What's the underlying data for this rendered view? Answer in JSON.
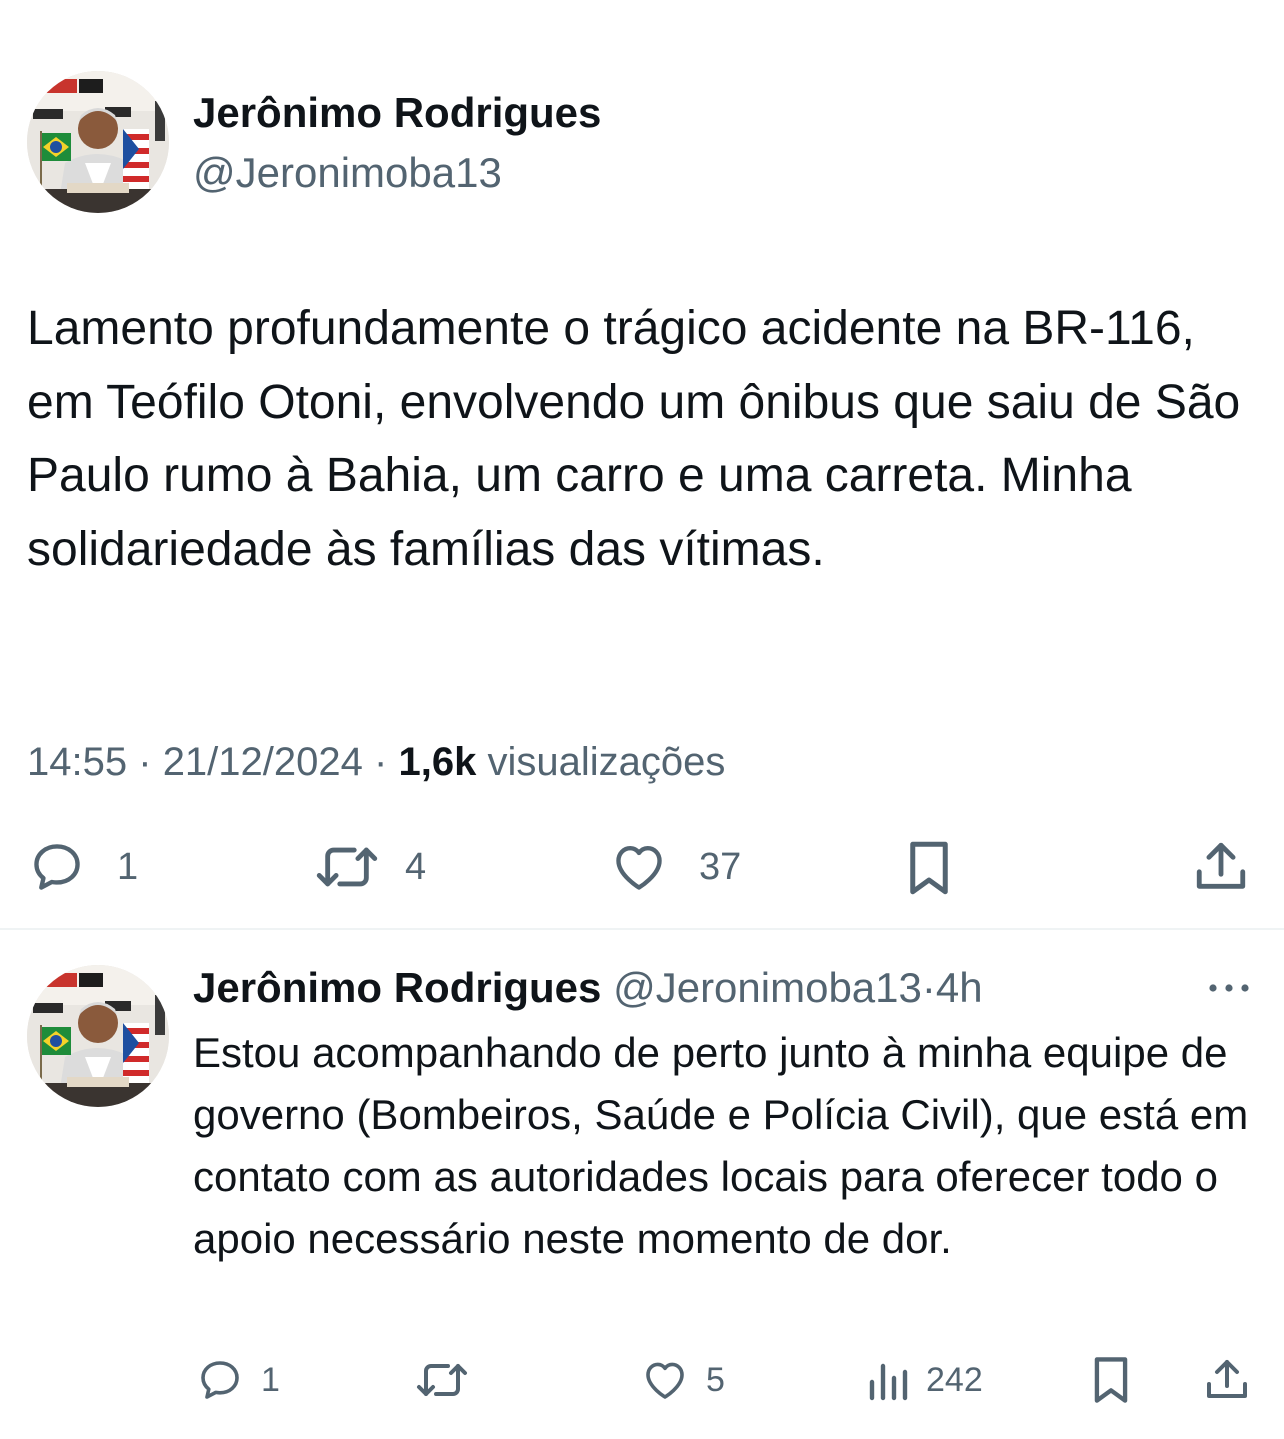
{
  "main_tweet": {
    "author": {
      "name": "Jerônimo Rodrigues",
      "handle": "@Jeronimoba13"
    },
    "text": "Lamento profundamente o trágico acidente na BR-116, em Teófilo Otoni, envolvendo um ônibus que saiu de São Paulo rumo à Bahia, um carro e uma carreta. Minha solidariedade às famílias das vítimas.",
    "time": "14:55",
    "separator": "·",
    "date": "21/12/2024",
    "views_count": "1,6k",
    "views_label": "visualizações",
    "actions": {
      "replies": "1",
      "reposts": "4",
      "likes": "37"
    }
  },
  "reply_tweet": {
    "author": {
      "name": "Jerônimo Rodrigues",
      "handle": "@Jeronimoba13"
    },
    "separator": "·",
    "time": "4h",
    "text": "Estou acompanhando de perto junto à minha equipe de governo (Bombeiros, Saúde e Polícia Civil), que está em contato com as autoridades locais para oferecer todo o apoio necessário neste momento de dor.",
    "actions": {
      "replies": "1",
      "reposts": "",
      "likes": "5",
      "views": "242"
    }
  },
  "icons": {
    "reply": "speech-bubble-icon",
    "repost": "repost-arrows-icon",
    "like": "heart-icon",
    "bookmark": "bookmark-icon",
    "share": "share-upload-icon",
    "views": "bar-chart-icon",
    "more": "more-dots-icon"
  },
  "colors": {
    "text_primary": "#0f1419",
    "text_secondary": "#536471",
    "divider": "#eff3f4"
  }
}
